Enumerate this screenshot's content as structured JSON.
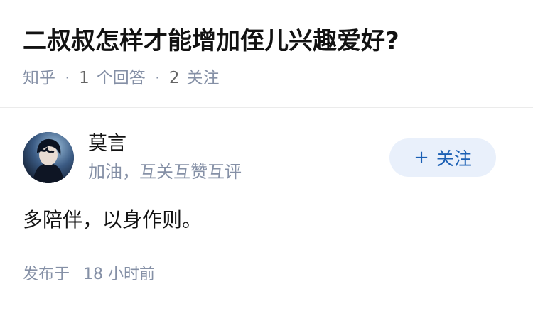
{
  "question": {
    "title": "二叔叔怎样才能增加侄儿兴趣爱好?",
    "source": "知乎",
    "separator": "·",
    "answer_count": "1",
    "answer_label": "个回答",
    "follower_count": "2",
    "follower_label": "关注"
  },
  "answer": {
    "author": {
      "name": "莫言",
      "bio": "加油，互关互赞互评",
      "avatar_icon": "avatar-image"
    },
    "follow_button": {
      "icon": "+",
      "label": "关注"
    },
    "content": "多陪伴，以身作则。",
    "published_label": "发布于",
    "published_time": "18 小时前"
  },
  "colors": {
    "accent": "#1a5fb4",
    "follow_bg": "#e9f0fb",
    "muted": "#8590a6",
    "text": "#121212"
  }
}
